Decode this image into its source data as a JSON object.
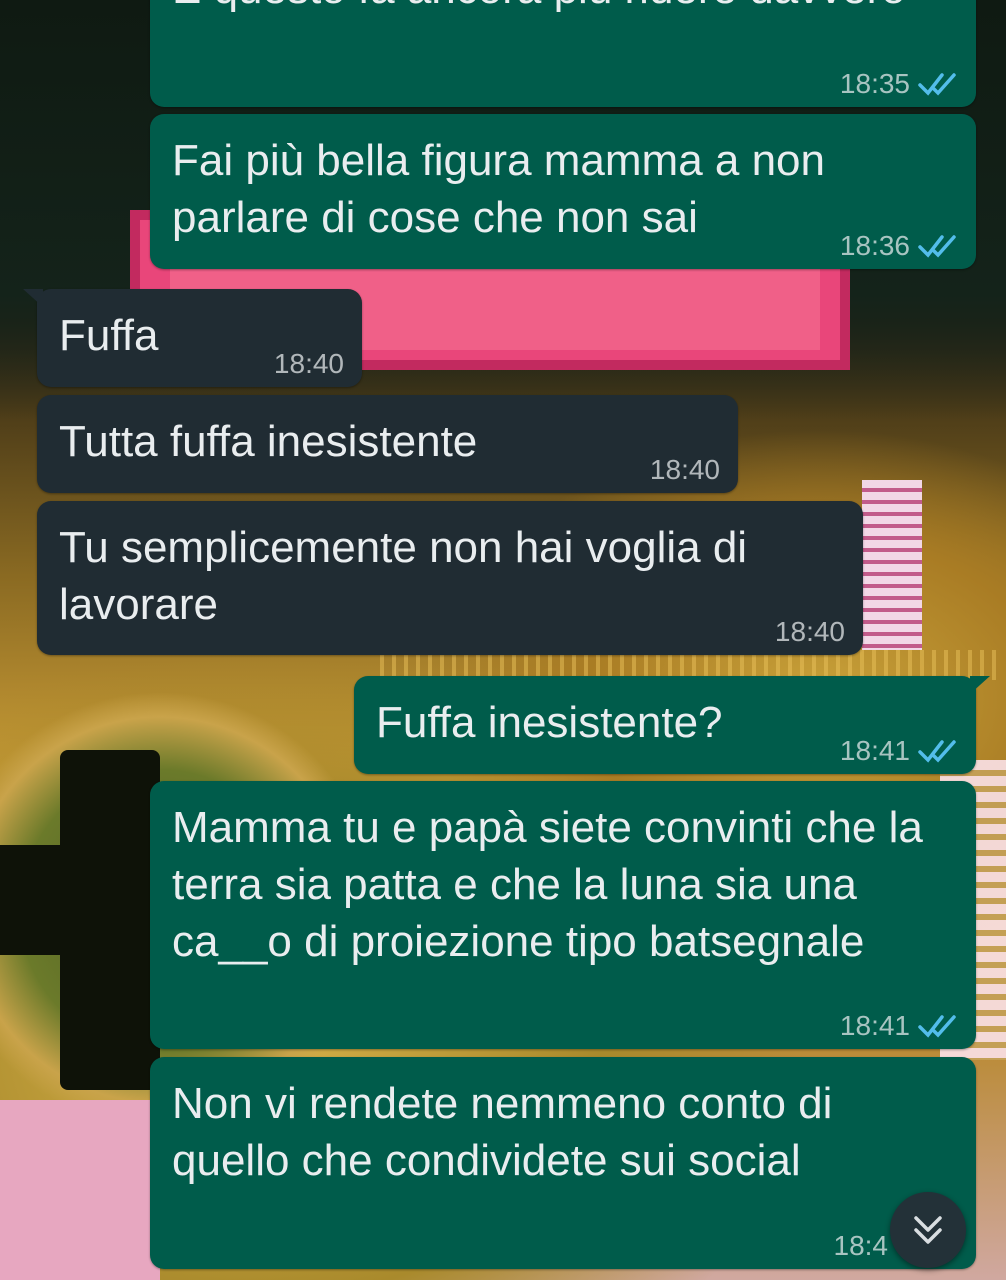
{
  "colors": {
    "outgoing_bubble": "#005c4b",
    "incoming_bubble": "#202c33",
    "text": "#e9edef",
    "read_ticks": "#53bdeb"
  },
  "messages": [
    {
      "direction": "outgoing",
      "text": "E questo fa ancora più ridere davvero",
      "time": "18:35",
      "status": "read"
    },
    {
      "direction": "outgoing",
      "text": "Fai più bella figura mamma a non parlare di cose che non sai",
      "time": "18:36",
      "status": "read"
    },
    {
      "direction": "incoming",
      "text": "Fuffa",
      "time": "18:40"
    },
    {
      "direction": "incoming",
      "text": "Tutta fuffa inesistente",
      "time": "18:40"
    },
    {
      "direction": "incoming",
      "text": "Tu semplicemente non hai voglia di lavorare",
      "time": "18:40"
    },
    {
      "direction": "outgoing",
      "text": "Fuffa inesistente?",
      "time": "18:41",
      "status": "read"
    },
    {
      "direction": "outgoing",
      "text": "Mamma tu e papà siete convinti che la terra sia patta e che la luna sia una ca__o di proiezione tipo batsegnale",
      "time": "18:41",
      "status": "read"
    },
    {
      "direction": "outgoing",
      "text": "Non vi rendete nemmeno conto di quello che condividete sui social",
      "time": "18:4"
    }
  ],
  "scroll_button": {
    "icon": "chevron-double-down-icon"
  },
  "read_icon": "double-check-icon"
}
